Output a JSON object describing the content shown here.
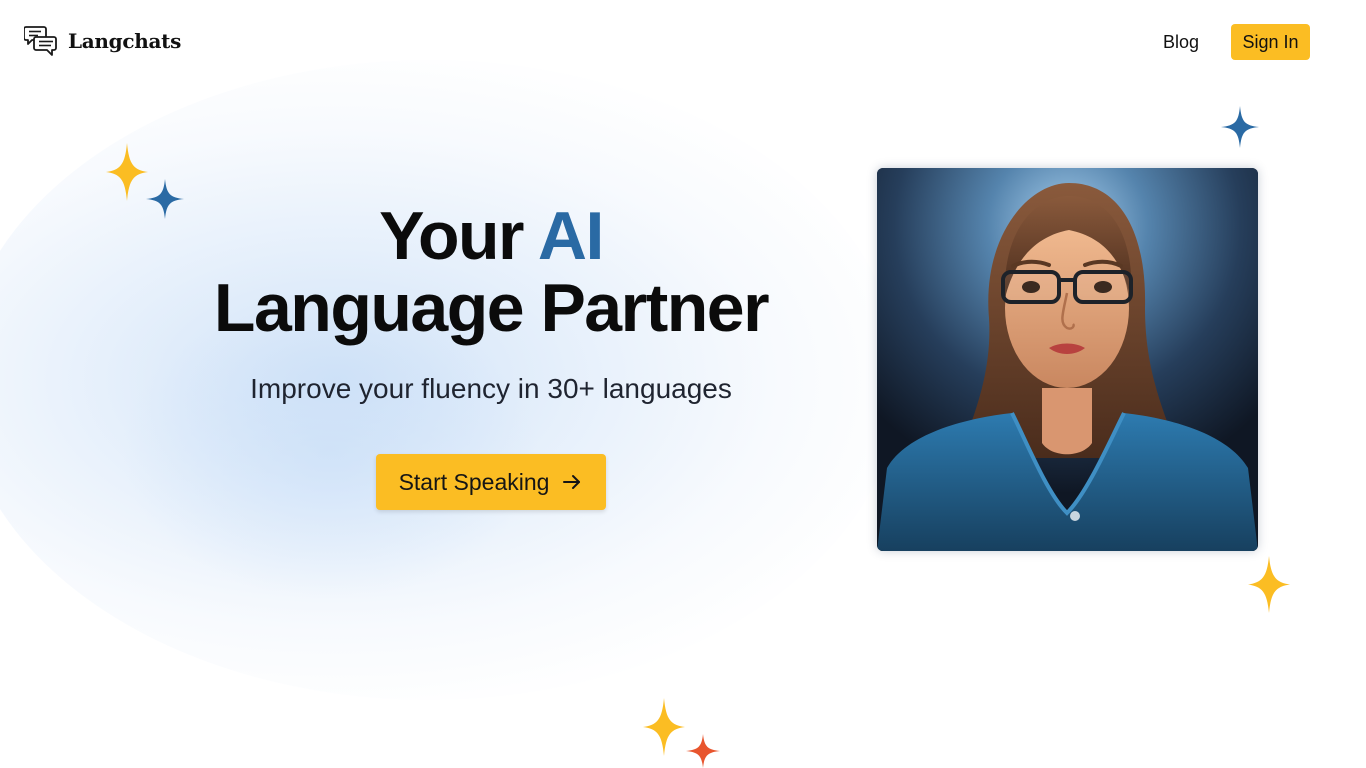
{
  "header": {
    "brand": "Langchats",
    "nav": {
      "blog_label": "Blog",
      "signin_label": "Sign In"
    }
  },
  "hero": {
    "headline_part1": "Your ",
    "headline_accent": "AI",
    "headline_line2": "Language Partner",
    "subtitle": "Improve your fluency in 30+ languages",
    "cta_label": "Start Speaking"
  },
  "icons": {
    "logo": "chat-bubbles-icon",
    "cta_arrow": "arrow-right-icon",
    "sparkle": "sparkle-icon"
  },
  "colors": {
    "accent_yellow": "#fbbd23",
    "accent_blue": "#2a6aa4",
    "sparkle_orange": "#e8552e"
  }
}
